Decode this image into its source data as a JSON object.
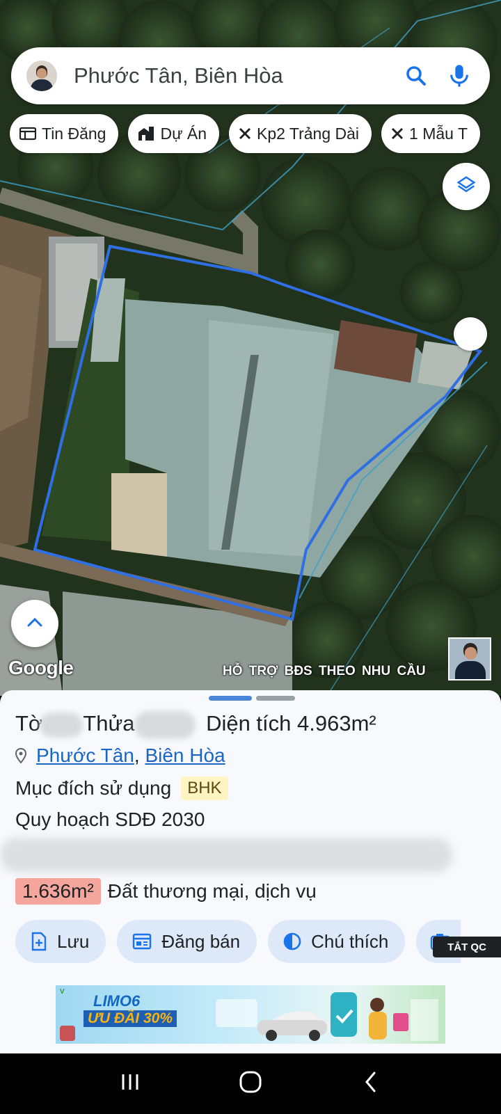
{
  "search": {
    "query": "Phước Tân, Biên Hòa"
  },
  "chips": [
    {
      "label": "Tin Đăng",
      "icon": "listing-icon"
    },
    {
      "label": "Dự Án",
      "icon": "building-icon"
    },
    {
      "label": "Kp2 Trảng Dài",
      "icon": "close-icon"
    },
    {
      "label": "1 Mẫu T",
      "icon": "close-icon"
    }
  ],
  "map": {
    "attribution": "Google",
    "support_text": "HỖ TRỢ BĐS  THEO NHU CẦU"
  },
  "parcel": {
    "title_prefix": "Tờ",
    "title_mid": "Thửa",
    "area_label": "Diện tích",
    "area_value": "4.963m²",
    "location_ward": "Phước Tân",
    "location_sep": ", ",
    "location_city": "Biên Hòa",
    "purpose_label": "Mục đích sử dụng",
    "purpose_code": "BHK",
    "plan_label": "Quy hoạch SDĐ 2030",
    "zone_area": "1.636m²",
    "zone_type": "Đất thương mại, dịch vụ"
  },
  "actions": [
    {
      "label": "Lưu",
      "icon": "save-icon"
    },
    {
      "label": "Đăng bán",
      "icon": "post-sale-icon"
    },
    {
      "label": "Chú thích",
      "icon": "legend-icon"
    }
  ],
  "ads": {
    "label": "TẮT QC",
    "banner_title": "LIMO6",
    "banner_offer": "ƯU ĐÃI 30%",
    "banner_brand": "V"
  },
  "colors": {
    "accent": "#1a66c7",
    "parcel_outline": "#2f6fe4",
    "zone_badge": "#f4a59c",
    "bhk_tag": "#fff4c2"
  }
}
